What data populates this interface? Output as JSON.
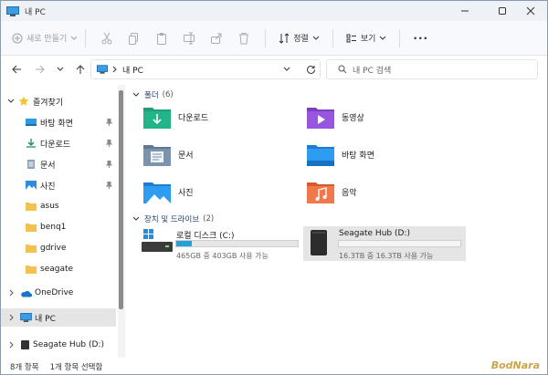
{
  "window": {
    "title": "내 PC"
  },
  "toolbar": {
    "new_label": "새로 만들기",
    "sort_label": "정렬",
    "view_label": "보기",
    "more_label": "···"
  },
  "address": {
    "path": "내 PC",
    "search_placeholder": "내 PC 검색"
  },
  "sidebar": {
    "quick_access": "즐겨찾기",
    "items": [
      {
        "label": "바탕 화면",
        "pinned": true
      },
      {
        "label": "다운로드",
        "pinned": true
      },
      {
        "label": "문서",
        "pinned": true
      },
      {
        "label": "사진",
        "pinned": true
      },
      {
        "label": "asus",
        "pinned": false
      },
      {
        "label": "benq1",
        "pinned": false
      },
      {
        "label": "gdrive",
        "pinned": false
      },
      {
        "label": "seagate",
        "pinned": false
      }
    ],
    "onedrive": "OneDrive",
    "this_pc": "내 PC",
    "seagate_drive": "Seagate Hub (D:)"
  },
  "main": {
    "folders_header": "폴더",
    "folders_count": "(6)",
    "folders": [
      {
        "label": "다운로드",
        "icon": "downloads-folder-icon"
      },
      {
        "label": "동영상",
        "icon": "videos-folder-icon"
      },
      {
        "label": "문서",
        "icon": "documents-folder-icon"
      },
      {
        "label": "바탕 화면",
        "icon": "desktop-folder-icon"
      },
      {
        "label": "사진",
        "icon": "pictures-folder-icon"
      },
      {
        "label": "음악",
        "icon": "music-folder-icon"
      }
    ],
    "drives_header": "장치 및 드라이브",
    "drives_count": "(2)",
    "drives": [
      {
        "label": "로컬 디스크 (C:)",
        "info": "465GB 중 403GB 사용 가능",
        "used_fraction": 0.13
      },
      {
        "label": "Seagate Hub (D:)",
        "info": "16.3TB 중 16.3TB 사용 가능",
        "used_fraction": 0.0
      }
    ]
  },
  "status": {
    "items": "8개 항목",
    "selected": "1개 항목 선택함"
  },
  "watermark": "BodNara",
  "colors": {
    "accent": "#0067c0",
    "selection": "#e5e5e5",
    "drive_bar": "#26a0da"
  }
}
